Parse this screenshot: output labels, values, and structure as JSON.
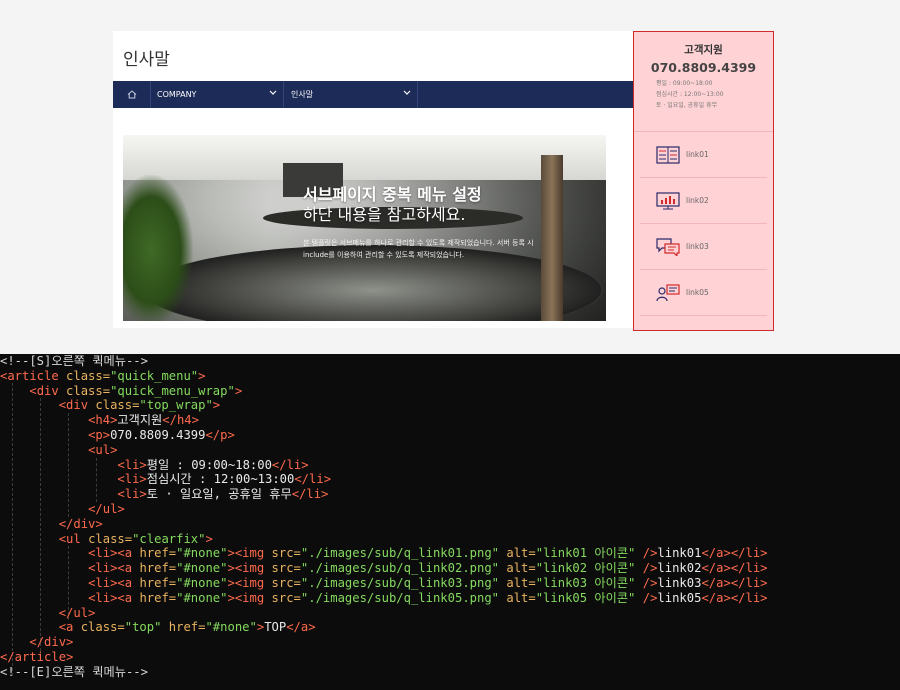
{
  "page": {
    "title": "인사말",
    "nav": {
      "item1": "COMPANY",
      "item2": "인사말"
    },
    "banner": {
      "title_bold": "서브페이지 중복 메뉴 설정",
      "title_light": "하단 내용을 참고하세요.",
      "desc_line1": "본 템플릿은 서브메뉴를 하나로 관리할 수 있도록 제작되었습니다. 서버 등록 시",
      "desc_line2": "include를 이용하여 관리할 수 있도록 제작되었습니다."
    }
  },
  "quick_menu": {
    "title": "고객지원",
    "phone": "070.8809.4399",
    "info": [
      "평일 : 09:00~18:00",
      "점심시간 : 12:00~13:00",
      "토 · 일요일, 공휴일 휴무"
    ],
    "links": [
      {
        "label": "link01",
        "icon": "document-list-icon"
      },
      {
        "label": "link02",
        "icon": "monitor-chart-icon"
      },
      {
        "label": "link03",
        "icon": "chat-bubbles-icon"
      },
      {
        "label": "link05",
        "icon": "person-monitor-icon"
      }
    ],
    "accent_color": "#d12a2a",
    "background_color": "#ffd2d5"
  },
  "code": {
    "l1": "<!--[S]오른쪽 퀵메뉴-->",
    "l2_tag": "<article ",
    "l2_attr": "class=",
    "l2_str": "\"quick_menu\"",
    "l2_end": ">",
    "l3_tag": "<div ",
    "l3_attr": "class=",
    "l3_str": "\"quick_menu_wrap\"",
    "l3_end": ">",
    "l4_tag": "<div ",
    "l4_attr": "class=",
    "l4_str": "\"top_wrap\"",
    "l4_end": ">",
    "l5_open": "<h4>",
    "l5_text": "고객지원",
    "l5_close": "</h4>",
    "l6_open": "<p>",
    "l6_text": "070.8809.4399",
    "l6_close": "</p>",
    "l7": "<ul>",
    "li_open": "<li>",
    "li_close": "</li>",
    "l8_text": "평일 : 09:00~18:00",
    "l9_text": "점심시간 : 12:00~13:00",
    "l10_text": "토 · 일요일, 공휴일 휴무",
    "l11": "</ul>",
    "l12": "</div>",
    "l13_tag": "<ul ",
    "l13_attr": "class=",
    "l13_str": "\"clearfix\"",
    "l13_end": ">",
    "a_open": "<a ",
    "href_attr": "href=",
    "href_val": "\"#none\"",
    "img_open": "<img ",
    "src_attr": "src=",
    "alt_attr": "alt=",
    "img_close": " />",
    "a_close": "</a>",
    "src1": "\"./images/sub/q_link01.png\"",
    "alt1": "\"link01 아이콘\"",
    "txt1": "link01",
    "src2": "\"./images/sub/q_link02.png\"",
    "alt2": "\"link02 아이콘\"",
    "txt2": "link02",
    "src3": "\"./images/sub/q_link03.png\"",
    "alt3": "\"link03 아이콘\"",
    "txt3": "link03",
    "src5": "\"./images/sub/q_link05.png\"",
    "alt5": "\"link05 아이콘\"",
    "txt5": "link05",
    "l18": "</ul>",
    "l19_tag": "<a ",
    "l19_attr1": "class=",
    "l19_str1": "\"top\"",
    "l19_attr2": " href=",
    "l19_str2": "\"#none\"",
    "l19_gt": ">",
    "l19_text": "TOP",
    "l19_close": "</a>",
    "l20": "</div>",
    "l21": "</article>",
    "l22": "<!--[E]오른쪽 퀵메뉴-->"
  }
}
